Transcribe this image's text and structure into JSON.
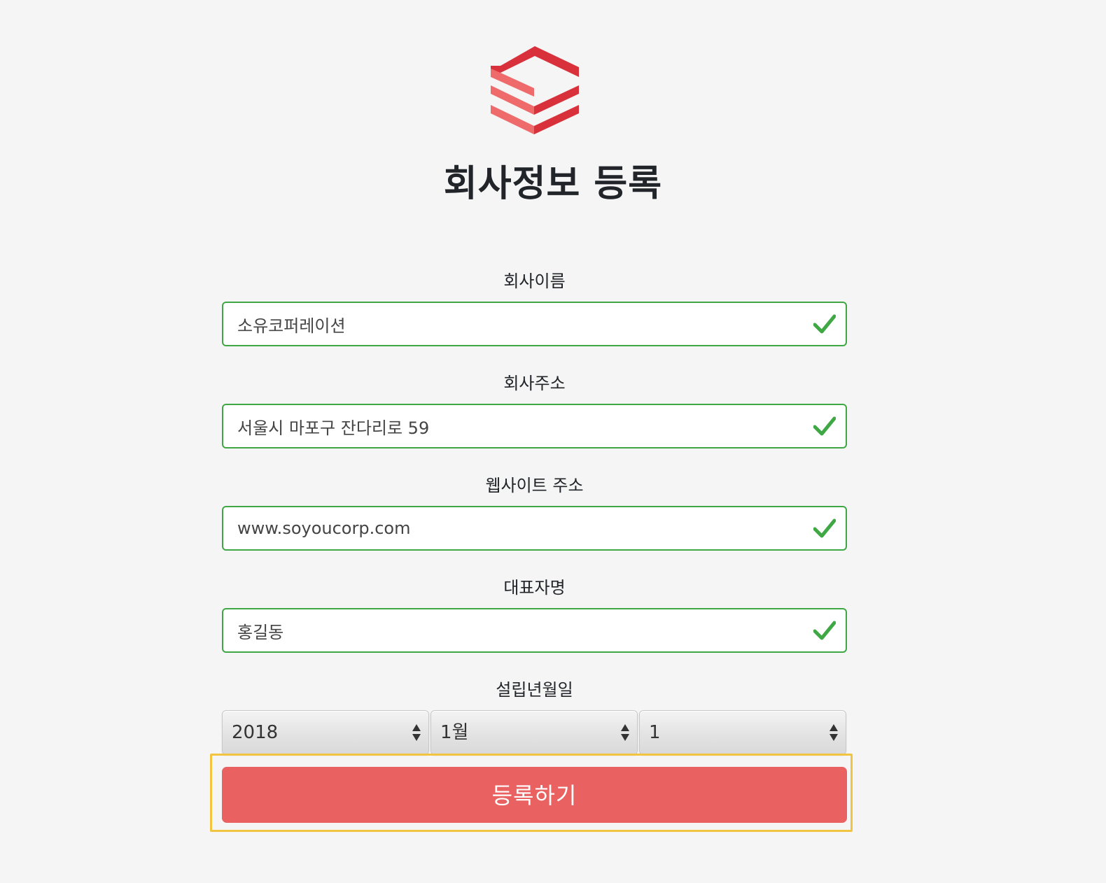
{
  "header": {
    "logo_icon": "stacked-layers-logo-icon",
    "title": "회사정보 등록"
  },
  "form": {
    "company_name": {
      "label": "회사이름",
      "value": "소유코퍼레이션",
      "status": "valid"
    },
    "company_address": {
      "label": "회사주소",
      "value": "서울시 마포구 잔다리로 59",
      "status": "valid"
    },
    "website": {
      "label": "웹사이트 주소",
      "value": "www.soyoucorp.com",
      "status": "valid"
    },
    "ceo_name": {
      "label": "대표자명",
      "value": "홍길동",
      "status": "valid"
    },
    "founded_date": {
      "label": "설립년월일",
      "year": "2018",
      "month": "1월",
      "day": "1"
    },
    "submit_label": "등록하기"
  },
  "colors": {
    "background": "#f5f5f5",
    "valid_border": "#3fa845",
    "valid_check": "#3fa845",
    "brand_red": "#e96160",
    "logo_dark_red": "#d8313b",
    "logo_light_red": "#ef6b6b",
    "highlight_outline": "#f2c43f"
  }
}
